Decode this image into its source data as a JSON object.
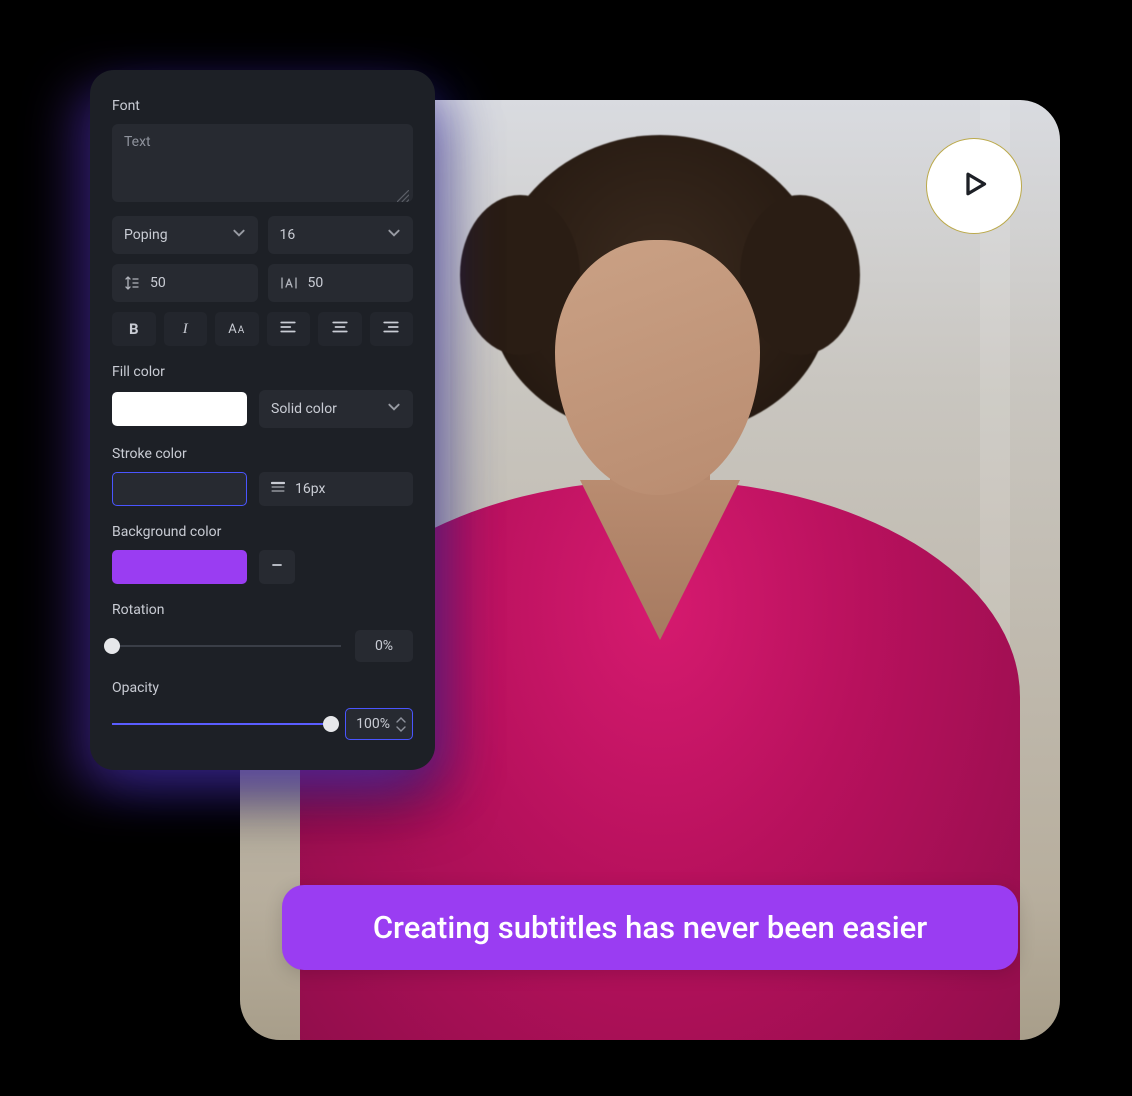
{
  "panel": {
    "font_label": "Font",
    "text_placeholder": "Text",
    "font_family": "Poping",
    "font_size": "16",
    "line_height": "50",
    "letter_spacing": "50",
    "fill_label": "Fill color",
    "fill_color": "#FFFFFF",
    "fill_mode": "Solid color",
    "stroke_label": "Stroke color",
    "stroke_size": "16px",
    "bg_label": "Background color",
    "bg_color": "#9A3DF2",
    "rotation_label": "Rotation",
    "rotation_value": "0%",
    "rotation_pct": 0,
    "opacity_label": "Opacity",
    "opacity_value": "100%",
    "opacity_pct": 100
  },
  "video": {
    "subtitle": "Creating subtitles has never been easier"
  },
  "colors": {
    "accent": "#9A3DF2",
    "panel_bg": "#1D2026",
    "highlight": "#4A55FF"
  }
}
